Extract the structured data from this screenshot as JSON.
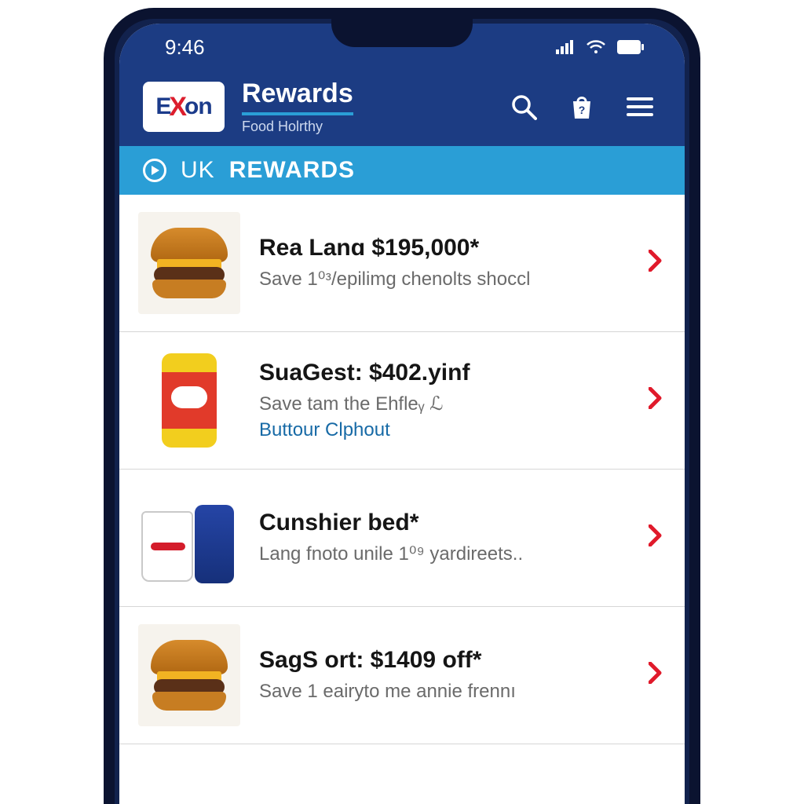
{
  "status": {
    "time": "9:46"
  },
  "header": {
    "logo": {
      "part1": "E",
      "part2": "X",
      "part3": "on"
    },
    "title": "Rewards",
    "subtitle": "Food Holrthy"
  },
  "subbanner": {
    "prefix": "UK",
    "label": "REWARDS"
  },
  "rows": [
    {
      "icon": "burger-icon",
      "title": "Rea Lanɑ $195,000*",
      "desc": "Save 1⁰ᵌ/epilimg chenolts shoccl",
      "link": null
    },
    {
      "icon": "soda-can-icon",
      "title": "SuaGest: $402.yinf",
      "desc": "Save tam the Ehfleᵧ ℒ",
      "link": "Buttour Clphout"
    },
    {
      "icon": "cup-and-can-icon",
      "title": "Cunshier bed*",
      "desc": "Lang fnoto unile 1⁰⁹ yardireets..",
      "link": null
    },
    {
      "icon": "burger-icon",
      "title": "SagS ort: $1409 off*",
      "desc": "Save 1 eairyto me annie frennı",
      "link": null
    }
  ]
}
